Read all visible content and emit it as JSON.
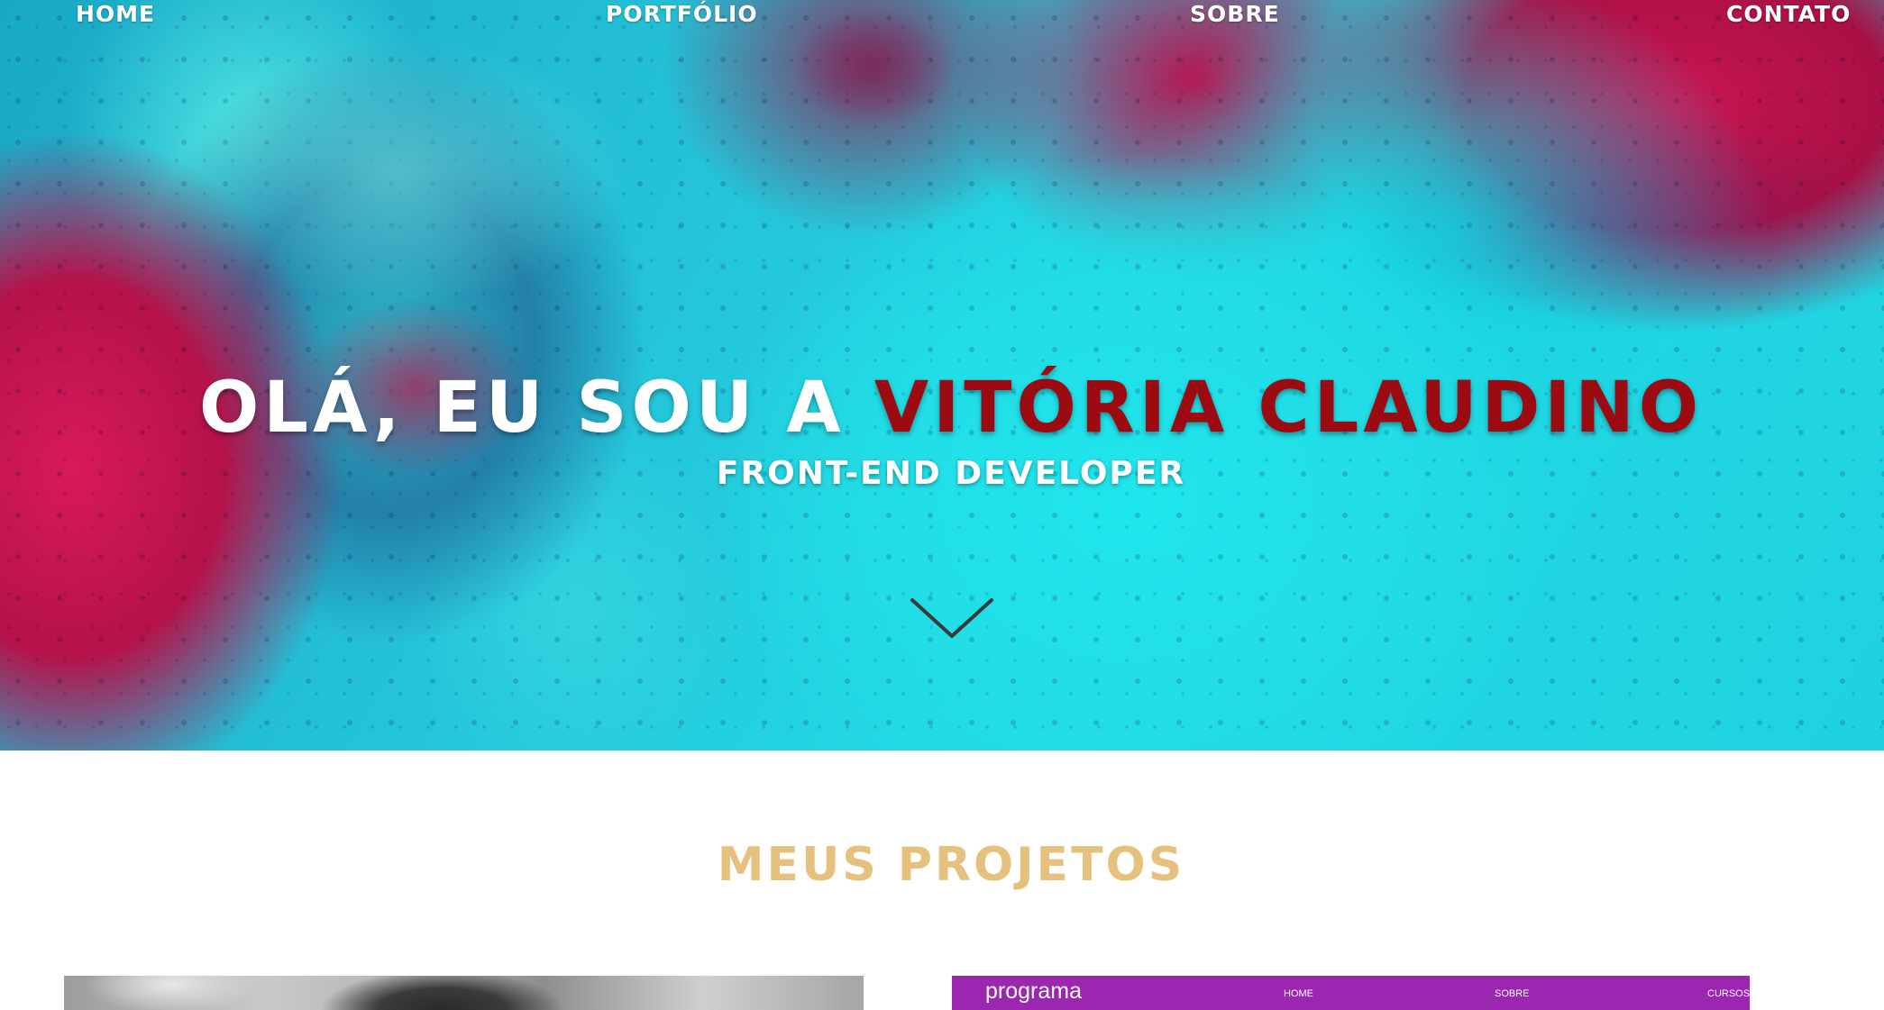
{
  "nav": {
    "items": [
      {
        "label": "HOME"
      },
      {
        "label": "PORTFÓLIO"
      },
      {
        "label": "SOBRE"
      },
      {
        "label": "CONTATO"
      }
    ]
  },
  "hero": {
    "greeting": "OLÁ, EU SOU A ",
    "name": "VITÓRIA CLAUDINO",
    "role": "FRONT-END DEVELOPER",
    "scroll_icon": "chevron-down-icon"
  },
  "projects": {
    "title": "MEUS PROJETOS",
    "cards": [
      {
        "kind": "photo-preview"
      },
      {
        "kind": "site-preview",
        "brand": "programa",
        "nav": [
          "HOME",
          "SOBRE",
          "CURSOS"
        ]
      }
    ]
  },
  "colors": {
    "name_accent": "#9c0a12",
    "section_title": "#e6c07d",
    "card_header": "#9b26b0"
  }
}
